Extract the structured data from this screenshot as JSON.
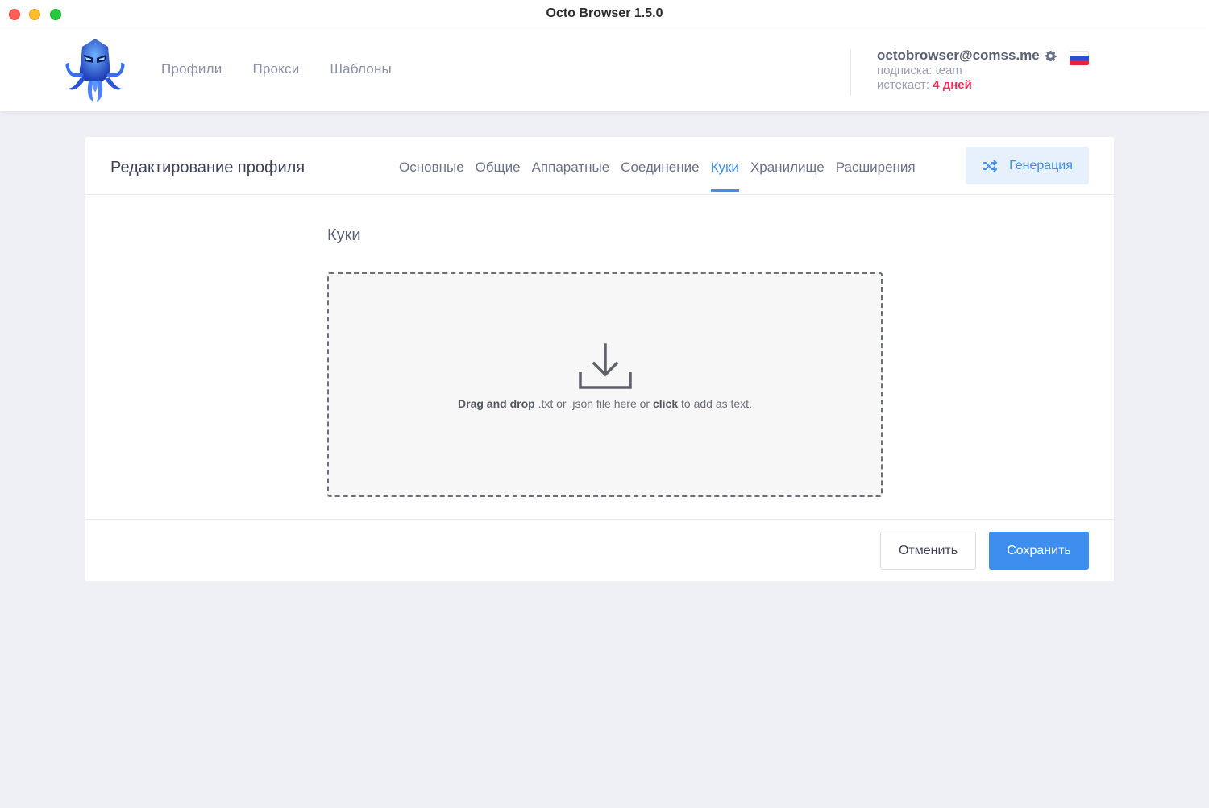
{
  "window": {
    "title": "Octo Browser 1.5.0"
  },
  "header": {
    "nav": [
      {
        "label": "Профили"
      },
      {
        "label": "Прокси"
      },
      {
        "label": "Шаблоны"
      }
    ],
    "account": {
      "email": "octobrowser@comss.me",
      "subscription": "подписка: team",
      "expires_label": "истекает:",
      "expires_value": "4 дней"
    },
    "language_flag": "ru-flag-icon"
  },
  "profile_editor": {
    "title": "Редактирование профиля",
    "tabs": [
      {
        "label": "Основные",
        "active": false
      },
      {
        "label": "Общие",
        "active": false
      },
      {
        "label": "Аппаратные",
        "active": false
      },
      {
        "label": "Соединение",
        "active": false
      },
      {
        "label": "Куки",
        "active": true
      },
      {
        "label": "Хранилище",
        "active": false
      },
      {
        "label": "Расширения",
        "active": false
      }
    ],
    "generate_label": "Генерация",
    "section_title": "Куки",
    "dropzone": {
      "strong1": "Drag and drop",
      "text1": " .txt or .json file here or ",
      "strong2": "click",
      "text2": " to add as text."
    },
    "cancel_label": "Отменить",
    "save_label": "Сохранить"
  },
  "colors": {
    "accent": "#3e8ef0",
    "accent_light": "#e6f1fd",
    "danger": "#f0305a",
    "background": "#eef0f5"
  }
}
